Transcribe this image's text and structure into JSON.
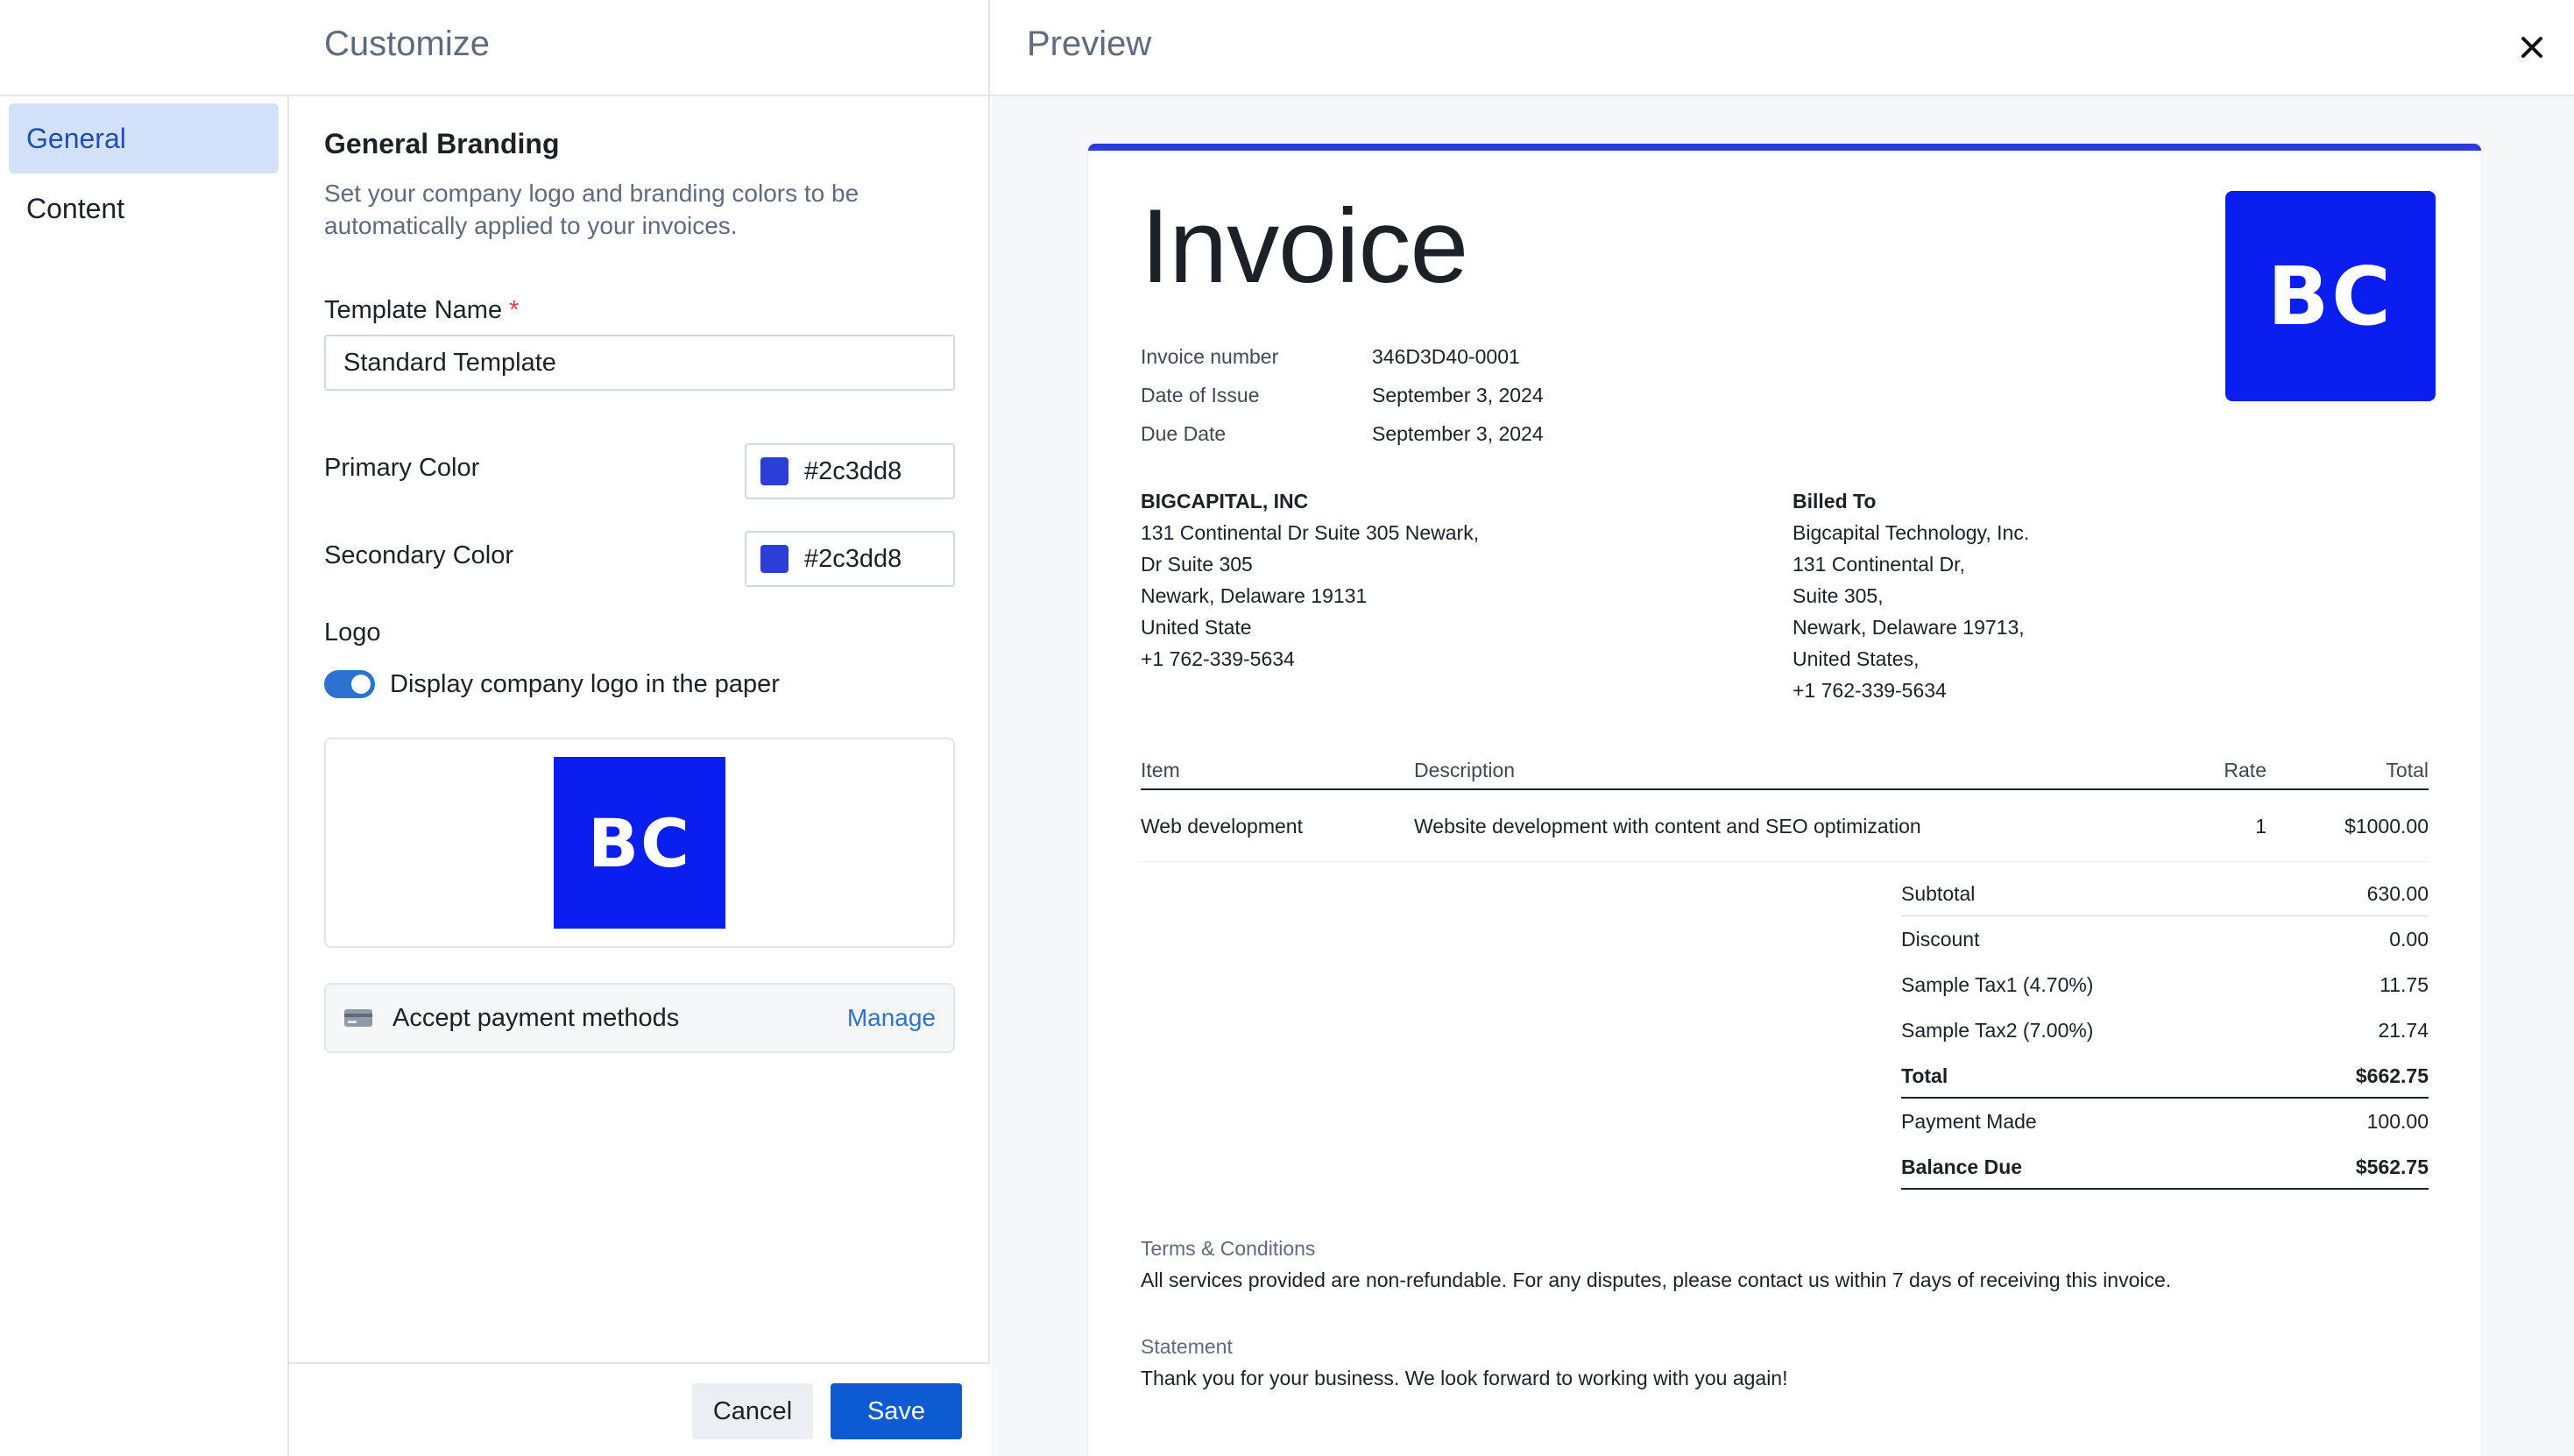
{
  "header": {
    "customize_title": "Customize",
    "preview_title": "Preview",
    "close_icon": "close-icon"
  },
  "nav": {
    "items": [
      {
        "label": "General",
        "active": true
      },
      {
        "label": "Content",
        "active": false
      }
    ]
  },
  "form": {
    "section_title": "General Branding",
    "section_desc": "Set your company logo and branding colors to be automatically applied to your invoices.",
    "template_name_label": "Template Name",
    "required_mark": "*",
    "template_name_value": "Standard Template",
    "primary_color_label": "Primary Color",
    "primary_color_value": "#2c3dd8",
    "secondary_color_label": "Secondary Color",
    "secondary_color_value": "#2c3dd8",
    "logo_label": "Logo",
    "logo_toggle_on": true,
    "logo_toggle_label": "Display company logo in the paper",
    "logo_text": "BC",
    "payment_label": "Accept payment methods",
    "payment_icon": "credit-card-icon",
    "manage_link": "Manage"
  },
  "footer": {
    "cancel_label": "Cancel",
    "save_label": "Save"
  },
  "invoice": {
    "title": "Invoice",
    "logo_text": "BC",
    "brand_color": "#2c3dd8",
    "logo_color": "#0A1EF0",
    "meta": [
      {
        "label": "Invoice number",
        "value": "346D3D40-0001"
      },
      {
        "label": "Date of Issue",
        "value": "September 3, 2024"
      },
      {
        "label": "Due Date",
        "value": "September 3, 2024"
      }
    ],
    "from": {
      "name": "BIGCAPITAL, INC",
      "lines": [
        "131 Continental Dr Suite 305 Newark,",
        "Dr Suite 305",
        "Newark, Delaware 19131",
        "United State",
        "+1 762-339-5634"
      ]
    },
    "billed_to": {
      "heading": "Billed To",
      "lines": [
        "Bigcapital Technology, Inc.",
        "131 Continental Dr,",
        "Suite 305,",
        "Newark, Delaware 19713,",
        "United States,",
        "+1 762-339-5634"
      ]
    },
    "table": {
      "headers": {
        "item": "Item",
        "description": "Description",
        "rate": "Rate",
        "total": "Total"
      },
      "rows": [
        {
          "item": "Web development",
          "description": "Website development with content and SEO optimization",
          "rate": "1",
          "total": "$1000.00"
        }
      ]
    },
    "totals": [
      {
        "label": "Subtotal",
        "value": "630.00"
      },
      {
        "label": "Discount",
        "value": "0.00"
      },
      {
        "label": "Sample Tax1 (4.70%)",
        "value": "11.75"
      },
      {
        "label": "Sample Tax2 (7.00%)",
        "value": "21.74"
      },
      {
        "label": "Total",
        "value": "$662.75"
      },
      {
        "label": "Payment Made",
        "value": "100.00"
      },
      {
        "label": "Balance Due",
        "value": "$562.75"
      }
    ],
    "terms_label": "Terms & Conditions",
    "terms_text": "All services provided are non-refundable. For any disputes, please contact us within 7 days of receiving this invoice.",
    "statement_label": "Statement",
    "statement_text": "Thank you for your business. We look forward to working with you again!"
  }
}
